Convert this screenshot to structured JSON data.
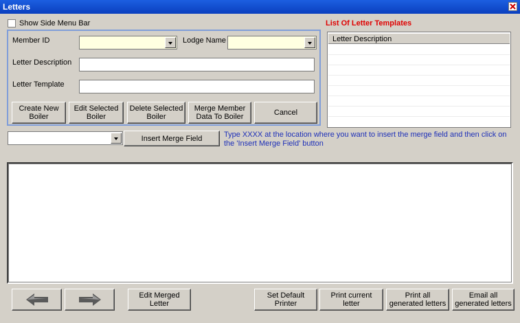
{
  "window": {
    "title": "Letters"
  },
  "show_side_menu": {
    "label": "Show Side Menu Bar",
    "checked": false
  },
  "form": {
    "member_id_label": "Member ID",
    "lodge_name_label": "Lodge Name",
    "letter_description_label": "Letter Description",
    "letter_template_label": "Letter Template",
    "member_id_value": "",
    "lodge_name_value": "",
    "letter_description_value": "",
    "letter_template_value": ""
  },
  "buttons": {
    "create_new_boiler": [
      "Create New",
      "Boiler"
    ],
    "edit_selected_boiler": [
      "Edit Selected",
      "Boiler"
    ],
    "delete_selected_boiler": [
      "Delete Selected",
      "Boiler"
    ],
    "merge_member_data": [
      "Merge Member",
      "Data To Boiler"
    ],
    "cancel": "Cancel",
    "insert_merge_field": "Insert Merge Field",
    "edit_merged_letter": [
      "Edit Merged",
      "Letter"
    ],
    "set_default_printer": [
      "Set Default",
      "Printer"
    ],
    "print_current_letter": "Print current letter",
    "print_all_generated": [
      "Print all",
      "generated letters"
    ],
    "email_all_generated": [
      "Email all",
      "generated letters"
    ]
  },
  "templates": {
    "title": "List Of Letter Templates",
    "column_header": "Letter Description",
    "rows": []
  },
  "merge_field": {
    "selected": "",
    "hint": "Type XXXX at the location where you want to insert the merge field and then click on the 'Insert Merge Field' button"
  },
  "icons": {
    "back": "left-arrow-icon",
    "forward": "right-arrow-icon",
    "close": "close-icon"
  }
}
